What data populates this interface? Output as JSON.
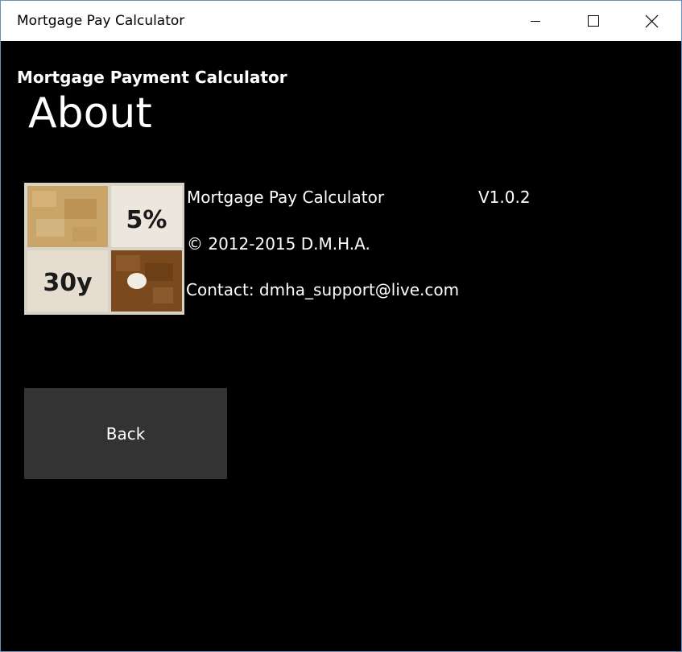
{
  "window": {
    "title": "Mortgage Pay Calculator",
    "controls": {
      "minimize_icon": "minimize-icon",
      "maximize_icon": "maximize-icon",
      "close_icon": "close-icon"
    }
  },
  "header": {
    "app_name": "Mortgage Payment Calculator",
    "page_title": "About"
  },
  "logo": {
    "icon": "logo-icon",
    "rate_label": "5%",
    "term_label": "30y"
  },
  "about": {
    "product_name": "Mortgage Pay Calculator",
    "version": "V1.0.2",
    "copyright": "© 2012-2015 D.M.H.A.",
    "contact": "Contact: dmha_support@live.com"
  },
  "actions": {
    "back_label": "Back"
  },
  "colors": {
    "background": "#000000",
    "titlebar": "#ffffff",
    "text": "#ffffff",
    "button": "#333333"
  }
}
